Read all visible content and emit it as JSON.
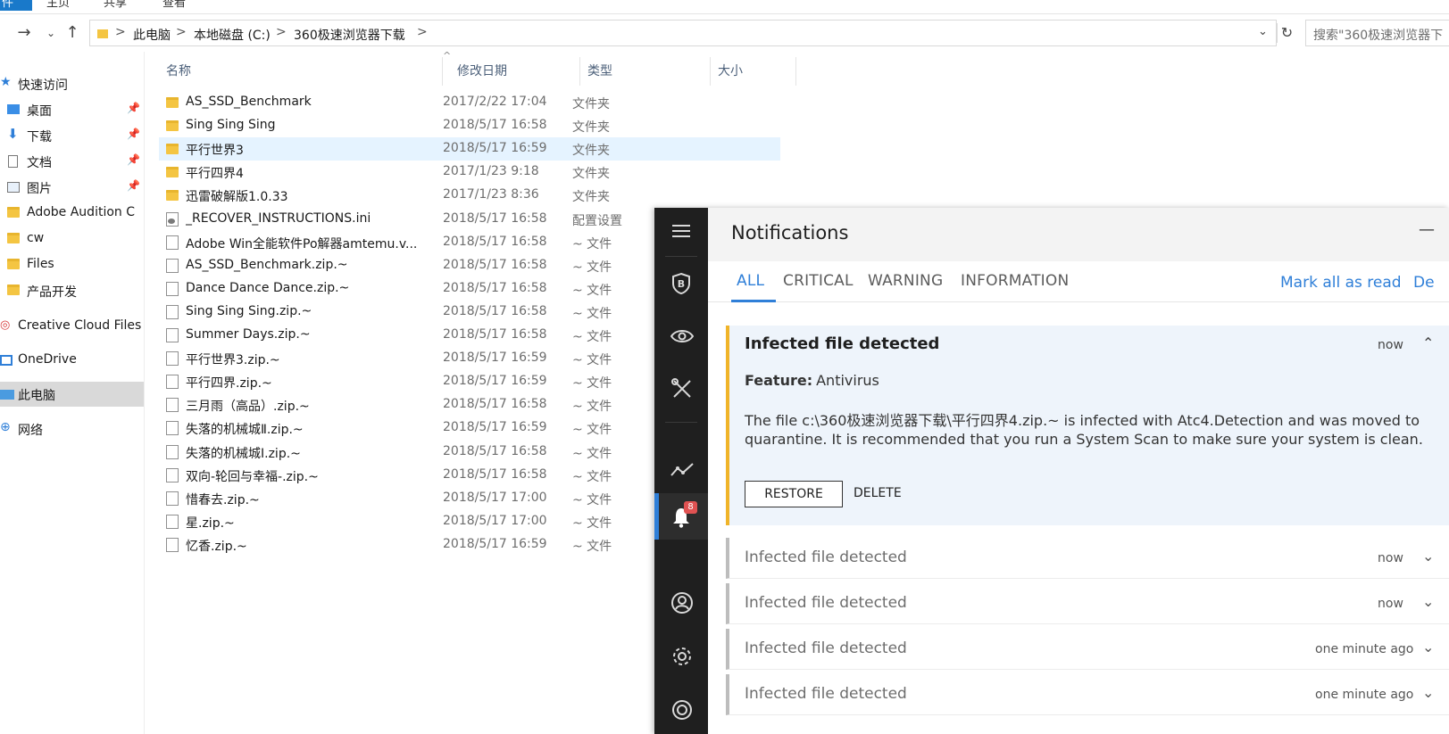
{
  "ribbon": {
    "file_tab": "件",
    "tabs": [
      "主页",
      "共享",
      "查看"
    ]
  },
  "address": {
    "breadcrumbs": [
      "此电脑",
      "本地磁盘 (C:)",
      "360极速浏览器下载"
    ],
    "separator": ">",
    "search_placeholder": "搜索\"360极速浏览器下"
  },
  "nav": {
    "items": [
      {
        "label": "快速访问",
        "pinned": false
      },
      {
        "label": "桌面",
        "pinned": true
      },
      {
        "label": "下载",
        "pinned": true
      },
      {
        "label": "文档",
        "pinned": true
      },
      {
        "label": "图片",
        "pinned": true
      },
      {
        "label": "Adobe Audition C",
        "pinned": false
      },
      {
        "label": "cw",
        "pinned": false
      },
      {
        "label": "Files",
        "pinned": false
      },
      {
        "label": "产品开发",
        "pinned": false
      },
      {
        "label": "Creative Cloud Files",
        "pinned": false
      },
      {
        "label": "OneDrive",
        "pinned": false
      },
      {
        "label": "此电脑",
        "pinned": false,
        "selected": true
      },
      {
        "label": "网络",
        "pinned": false
      }
    ]
  },
  "filelist": {
    "columns": {
      "name": "名称",
      "date": "修改日期",
      "type": "类型",
      "size": "大小"
    },
    "rows": [
      {
        "name": "AS_SSD_Benchmark",
        "date": "2017/2/22 17:04",
        "type": "文件夹",
        "kind": "folder"
      },
      {
        "name": "Sing Sing Sing",
        "date": "2018/5/17 16:58",
        "type": "文件夹",
        "kind": "folder"
      },
      {
        "name": "平行世界3",
        "date": "2018/5/17 16:59",
        "type": "文件夹",
        "kind": "folder",
        "selected": true
      },
      {
        "name": "平行四界4",
        "date": "2017/1/23 9:18",
        "type": "文件夹",
        "kind": "folder"
      },
      {
        "name": "迅雷破解版1.0.33",
        "date": "2017/1/23 8:36",
        "type": "文件夹",
        "kind": "folder"
      },
      {
        "name": "_RECOVER_INSTRUCTIONS.ini",
        "date": "2018/5/17 16:58",
        "type": "配置设置",
        "kind": "ini"
      },
      {
        "name": "Adobe Win全能软件Po解器amtemu.v...",
        "date": "2018/5/17 16:58",
        "type": "~ 文件",
        "kind": "file"
      },
      {
        "name": "AS_SSD_Benchmark.zip.~",
        "date": "2018/5/17 16:58",
        "type": "~ 文件",
        "kind": "file"
      },
      {
        "name": "Dance Dance Dance.zip.~",
        "date": "2018/5/17 16:58",
        "type": "~ 文件",
        "kind": "file"
      },
      {
        "name": "Sing Sing Sing.zip.~",
        "date": "2018/5/17 16:58",
        "type": "~ 文件",
        "kind": "file"
      },
      {
        "name": "Summer Days.zip.~",
        "date": "2018/5/17 16:58",
        "type": "~ 文件",
        "kind": "file"
      },
      {
        "name": "平行世界3.zip.~",
        "date": "2018/5/17 16:59",
        "type": "~ 文件",
        "kind": "file"
      },
      {
        "name": "平行四界.zip.~",
        "date": "2018/5/17 16:59",
        "type": "~ 文件",
        "kind": "file"
      },
      {
        "name": "三月雨（高品）.zip.~",
        "date": "2018/5/17 16:58",
        "type": "~ 文件",
        "kind": "file"
      },
      {
        "name": "失落的机械城Ⅱ.zip.~",
        "date": "2018/5/17 16:59",
        "type": "~ 文件",
        "kind": "file"
      },
      {
        "name": "失落的机械城Ⅰ.zip.~",
        "date": "2018/5/17 16:58",
        "type": "~ 文件",
        "kind": "file"
      },
      {
        "name": "双向-轮回与幸福-.zip.~",
        "date": "2018/5/17 16:58",
        "type": "~ 文件",
        "kind": "file"
      },
      {
        "name": "惜春去.zip.~",
        "date": "2018/5/17 17:00",
        "type": "~ 文件",
        "kind": "file"
      },
      {
        "name": "星.zip.~",
        "date": "2018/5/17 17:00",
        "type": "~ 文件",
        "kind": "file"
      },
      {
        "name": "忆香.zip.~",
        "date": "2018/5/17 16:59",
        "type": "~ 文件",
        "kind": "file"
      }
    ]
  },
  "security": {
    "badge_count": "8",
    "header_title": "Notifications",
    "minimize": "—",
    "tabs": [
      "ALL",
      "CRITICAL",
      "WARNING",
      "INFORMATION"
    ],
    "mark_all_read": "Mark all as read",
    "delete_all": "De",
    "expanded": {
      "title": "Infected file detected",
      "time": "now",
      "feature_label": "Feature:",
      "feature_value": "Antivirus",
      "description": "The file c:\\360极速浏览器下载\\平行四界4.zip.~ is infected with Atc4.Detection and was moved to quarantine. It is recommended that you run a System Scan to make sure your system is clean.",
      "restore": "RESTORE",
      "delete": "DELETE"
    },
    "collapsed": [
      {
        "title": "Infected file detected",
        "time": "now"
      },
      {
        "title": "Infected file detected",
        "time": "now"
      },
      {
        "title": "Infected file detected",
        "time": "one minute ago"
      },
      {
        "title": "Infected file detected",
        "time": "one minute ago"
      }
    ],
    "colors": {
      "accent": "#2f7fd8",
      "warning": "#f0b429",
      "sidebar": "#1f1f1f"
    }
  }
}
